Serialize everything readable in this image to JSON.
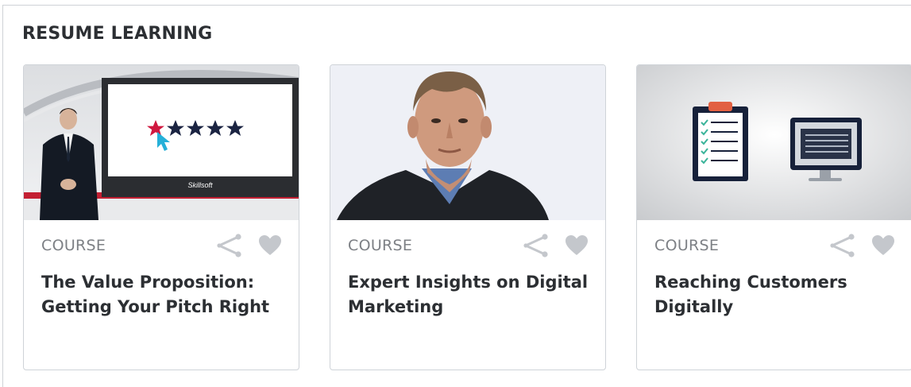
{
  "section": {
    "title": "RESUME LEARNING"
  },
  "cards": [
    {
      "type": "COURSE",
      "title": "The Value Proposition: Getting Your Pitch Right",
      "thumbnail": "presenter-with-rating-screen",
      "screen_logo": "Skillsoft",
      "share_icon": "share-icon",
      "favorite_icon": "heart-icon"
    },
    {
      "type": "COURSE",
      "title": "Expert Insights on Digital Marketing",
      "thumbnail": "expert-portrait",
      "share_icon": "share-icon",
      "favorite_icon": "heart-icon"
    },
    {
      "type": "COURSE",
      "title": "Reaching Customers Digitally",
      "thumbnail": "clipboard-and-monitor-illustration",
      "share_icon": "share-icon",
      "favorite_icon": "heart-icon"
    }
  ],
  "colors": {
    "icon": "#c4c7cc",
    "star_highlight": "#d0183f",
    "star": "#1b2442",
    "cursor": "#26b0d8",
    "text_primary": "#2c2f33",
    "text_secondary": "#7d8085"
  }
}
